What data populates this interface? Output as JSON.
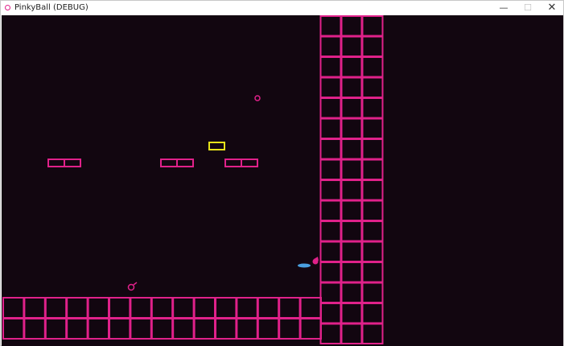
{
  "window": {
    "title": "PinkyBall (DEBUG)",
    "app_icon": "pinky-ball-icon",
    "controls": {
      "minimize_glyph": "—",
      "maximize_glyph": "☐",
      "close_glyph": "✕"
    }
  },
  "game": {
    "background_color": "#120610",
    "tile_color": "#e0218a",
    "highlight_brick_color": "#e6e21a",
    "paddle_color": "#4a9fe0",
    "ball_color": "#e0218a",
    "bricks": [
      {
        "kind": "double",
        "color": "pink"
      },
      {
        "kind": "double",
        "color": "pink"
      },
      {
        "kind": "double",
        "color": "pink"
      },
      {
        "kind": "single",
        "color": "yellow"
      }
    ],
    "small_ring_item": "ring-pickup",
    "player_marker": "player-ball"
  }
}
